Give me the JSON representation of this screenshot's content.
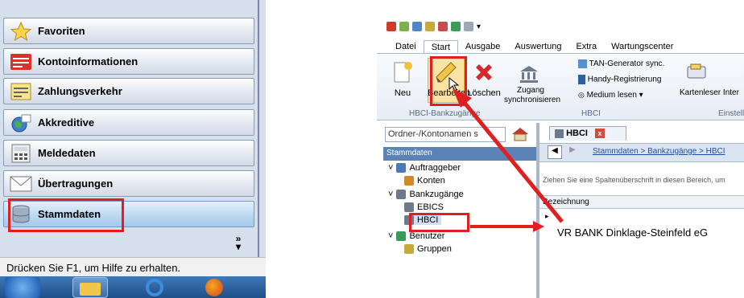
{
  "left_nav": {
    "items": [
      {
        "label": "Favoriten",
        "icon": "star-icon"
      },
      {
        "label": "Kontoinformationen",
        "icon": "account-info-icon"
      },
      {
        "label": "Zahlungsverkehr",
        "icon": "payments-icon"
      },
      {
        "label": "Akkreditive",
        "icon": "globe-icon"
      },
      {
        "label": "Meldedaten",
        "icon": "calculator-icon"
      },
      {
        "label": "Übertragungen",
        "icon": "envelope-icon"
      },
      {
        "label": "Stammdaten",
        "icon": "database-icon"
      }
    ],
    "more_glyph": "»",
    "status_text": "Drücken Sie F1, um Hilfe zu erhalten."
  },
  "app": {
    "tabs": [
      "Datei",
      "Start",
      "Ausgabe",
      "Auswertung",
      "Extra",
      "Wartungscenter"
    ],
    "active_tab": "Start",
    "ribbon": {
      "neu": "Neu",
      "bearbeiten": "Bearbeiten",
      "loeschen": "Löschen",
      "group_bank": "HBCI-Bankzugänge",
      "zugang": "Zugang synchronisieren",
      "tan_generator": "TAN-Generator sync.",
      "handy": "Handy-Registrierung",
      "medium": "Medium lesen",
      "group_hbci": "HBCI",
      "kartenleser": "Kartenleser Inter",
      "group_einstell": "Einstell"
    },
    "search_placeholder": "Ordner-/Kontonamen s",
    "nav_header": "Stammdaten",
    "tree": {
      "auftraggeber": "Auftraggeber",
      "konten": "Konten",
      "bankzugaenge": "Bankzugänge",
      "ebics": "EBICS",
      "hbci": "HBCI",
      "benutzer": "Benutzer",
      "gruppen": "Gruppen"
    },
    "doc_tab": "HBCI",
    "breadcrumb": "Stammdaten > Bankzugänge > HBCI",
    "group_hint": "Ziehen Sie eine Spaltenüberschrift in diesen Bereich, um",
    "column_header": "Bezeichnung",
    "row_bank": "VR BANK Dinklage-Steinfeld eG"
  },
  "colors": {
    "highlight": "#e02020",
    "nav_active": "#bcd8f1",
    "header_blue": "#5b83b8"
  }
}
